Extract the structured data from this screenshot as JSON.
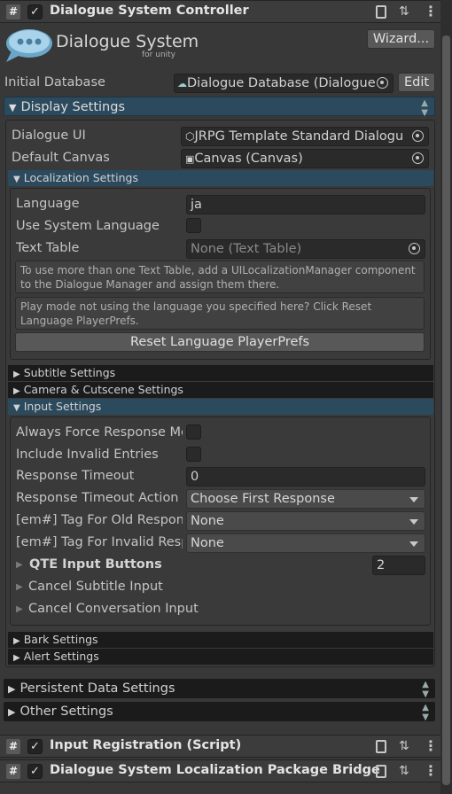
{
  "components": {
    "dialogue_system_controller": {
      "title": "Dialogue System Controller"
    },
    "input_registration": {
      "title": "Input Registration (Script)"
    },
    "localization_bridge": {
      "title": "Dialogue System Localization Package Bridge"
    }
  },
  "header_icons": {
    "hash": "#",
    "check": "✓",
    "sliders": "⇅",
    "dots": "⋮"
  },
  "logo": {
    "title": "Dialogue System",
    "subtitle": "for unity"
  },
  "wizard_button": "Wizard...",
  "initial_database": {
    "label": "Initial Database",
    "value": "Dialogue Database (Dialogue",
    "edit_label": "Edit"
  },
  "display_settings": {
    "header": "Display Settings",
    "dialogue_ui": {
      "label": "Dialogue UI",
      "value": "JRPG Template Standard Dialogu"
    },
    "default_canvas": {
      "label": "Default Canvas",
      "value": "Canvas (Canvas)"
    },
    "localization": {
      "header": "Localization Settings",
      "language": {
        "label": "Language",
        "value": "ja"
      },
      "use_system_language": {
        "label": "Use System Language",
        "checked": false
      },
      "text_table": {
        "label": "Text Table",
        "value": "None (Text Table)"
      },
      "help1": "To use more than one Text Table, add a UILocalizationManager component to the Dialogue Manager and assign them there.",
      "help2": "Play mode not using the language you specified here? Click Reset Language PlayerPrefs.",
      "reset_button": "Reset Language PlayerPrefs"
    },
    "subtitle_settings": "Subtitle Settings",
    "camera_settings": "Camera & Cutscene Settings",
    "input_settings": {
      "header": "Input Settings",
      "always_force": {
        "label": "Always Force Response Menu",
        "checked": false
      },
      "include_invalid": {
        "label": "Include Invalid Entries",
        "checked": false
      },
      "response_timeout": {
        "label": "Response Timeout",
        "value": "0"
      },
      "response_timeout_action": {
        "label": "Response Timeout Action",
        "value": "Choose First Response"
      },
      "em_old": {
        "label": "[em#] Tag For Old Responses",
        "value": "None"
      },
      "em_invalid": {
        "label": "[em#] Tag For Invalid Responses",
        "value": "None"
      },
      "qte": {
        "label": "QTE Input Buttons",
        "value": "2"
      },
      "cancel_subtitle": "Cancel Subtitle Input",
      "cancel_conversation": "Cancel Conversation Input"
    },
    "bark_settings": "Bark Settings",
    "alert_settings": "Alert Settings"
  },
  "persistent_data": "Persistent Data Settings",
  "other_settings": "Other Settings",
  "colors": {
    "accent_blue": "#2c4a5e",
    "panel": "#383838",
    "field": "#2a2a2a"
  }
}
